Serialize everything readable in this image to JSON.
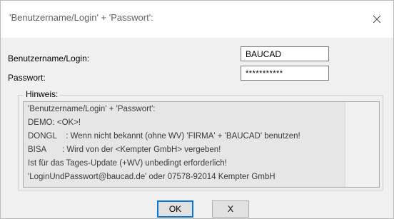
{
  "window": {
    "title": "'Benutzername/Login' + 'Passwort':"
  },
  "form": {
    "username_label": "Benutzername/Login:",
    "username_value": "BAUCAD",
    "password_label": "Passwort:",
    "password_value": "***********"
  },
  "hint": {
    "title": "Hinweis:",
    "lines": [
      "'Benutzername/Login' + 'Passwort':",
      "DEMO: <OK>!",
      "DONGL    : Wenn nicht bekannt (ohne WV) 'FIRMA' + 'BAUCAD' benutzen!",
      "BISA       : Wird von der <Kempter GmbH> vergeben!",
      "Ist für das Tages-Update (+WV) unbedingt erforderlich!",
      "'LoginUndPasswort@baucad.de' oder 07578-92014 Kempter GmbH"
    ]
  },
  "buttons": {
    "ok_label": "OK",
    "cancel_label": "X"
  },
  "colors": {
    "accent": "#0078d7",
    "hint_background": "#e6e6e6",
    "dialog_background": "#f0f0f0"
  },
  "icons": {
    "close": "close-icon"
  }
}
